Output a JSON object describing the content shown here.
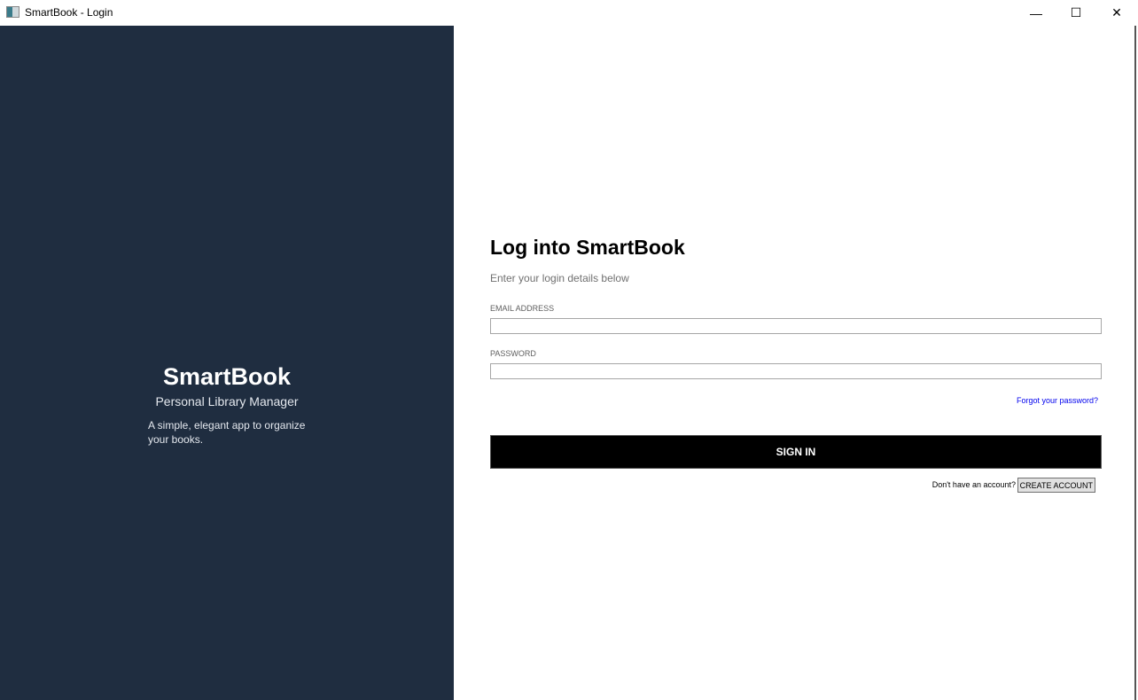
{
  "window": {
    "title": "SmartBook - Login",
    "minimize": "—",
    "maximize": "☐",
    "close": "✕"
  },
  "brand": {
    "name": "SmartBook",
    "tagline": "Personal Library Manager",
    "description": "A simple, elegant app to organize your books."
  },
  "form": {
    "heading": "Log into SmartBook",
    "subheading": "Enter your login details below",
    "email_label": "EMAIL ADDRESS",
    "email_value": "",
    "password_label": "PASSWORD",
    "password_value": "",
    "forgot_link": "Forgot your password?",
    "sign_in": "SIGN IN",
    "no_account": "Don't have an account?",
    "create_account": "CREATE ACCOUNT"
  }
}
